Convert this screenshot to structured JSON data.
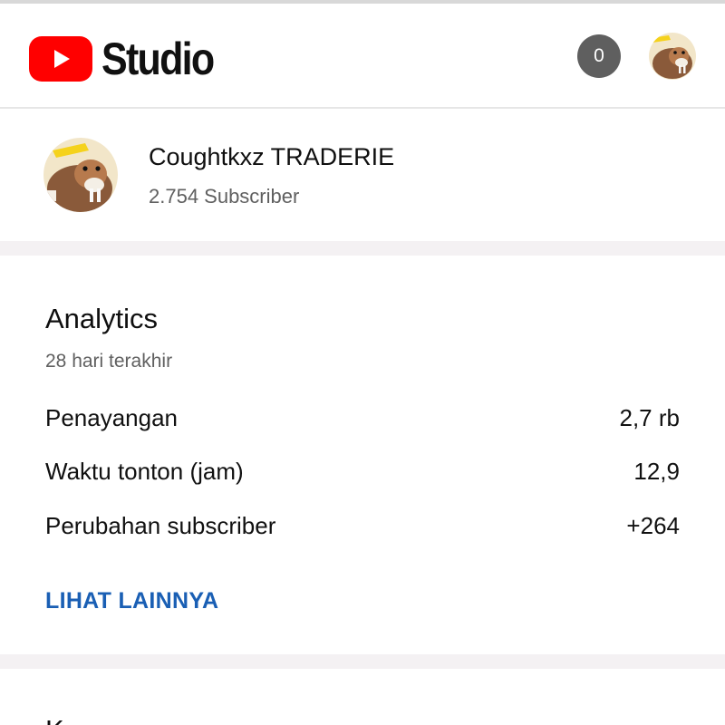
{
  "app": {
    "logo_text": "Studio",
    "brand_color": "#ff0000"
  },
  "header": {
    "notification_count": "0"
  },
  "channel": {
    "name": "Coughtkxz TRADERIE",
    "subscribers": "2.754 Subscriber"
  },
  "analytics": {
    "title": "Analytics",
    "period": "28 hari terakhir",
    "metrics": [
      {
        "label": "Penayangan",
        "value": "2,7 rb"
      },
      {
        "label": "Waktu tonton (jam)",
        "value": "12,9"
      },
      {
        "label": "Perubahan subscriber",
        "value": "+264"
      }
    ],
    "see_more": "LIHAT LAINNYA",
    "link_color": "#1a5fb4"
  },
  "next_card": {
    "title": "K"
  }
}
